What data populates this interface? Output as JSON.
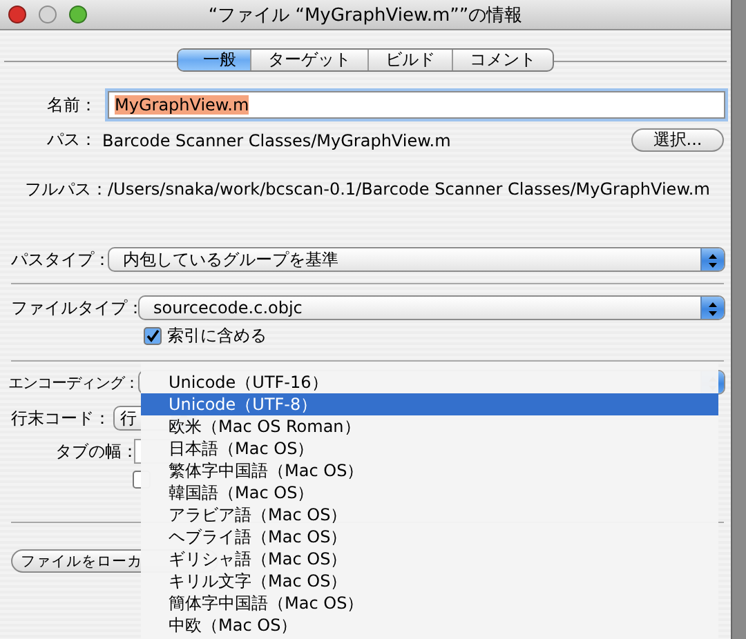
{
  "window": {
    "title": "“ファイル “MyGraphView.m””の情報"
  },
  "tabs": [
    {
      "label": "一般",
      "selected": true
    },
    {
      "label": "ターゲット",
      "selected": false
    },
    {
      "label": "ビルド",
      "selected": false
    },
    {
      "label": "コメント",
      "selected": false
    }
  ],
  "name": {
    "label": "名前：",
    "value": "MyGraphView.m",
    "text_selected": true
  },
  "path": {
    "label": "パス：",
    "value": "Barcode Scanner Classes/MyGraphView.m",
    "button": "選択..."
  },
  "full_path": {
    "label": "フルパス：",
    "value": "/Users/snaka/work/bcscan-0.1/Barcode Scanner Classes/MyGraphView.m"
  },
  "path_type": {
    "label": "パスタイプ：",
    "value": "内包しているグループを基準"
  },
  "file_type": {
    "label": "ファイルタイプ：",
    "value": "sourcecode.c.objc"
  },
  "index_checkbox": {
    "label": "索引に含める",
    "checked": true
  },
  "encoding": {
    "label": "エンコーディング："
  },
  "line_ending": {
    "label": "行末コード：",
    "value": "行"
  },
  "tab_width": {
    "label": "タブの幅："
  },
  "option_checkbox": {
    "checked": false
  },
  "localize_button": {
    "label": "ファイルをローカ"
  },
  "encoding_menu": {
    "items": [
      {
        "label": "Unicode（UTF-16）",
        "selected": false
      },
      {
        "label": "Unicode（UTF-8）",
        "selected": true
      },
      {
        "label": "欧米（Mac OS Roman）",
        "selected": false
      },
      {
        "label": "日本語（Mac OS）",
        "selected": false
      },
      {
        "label": "繁体字中国語（Mac OS）",
        "selected": false
      },
      {
        "label": "韓国語（Mac OS）",
        "selected": false
      },
      {
        "label": "アラビア語（Mac OS）",
        "selected": false
      },
      {
        "label": "ヘブライ語（Mac OS）",
        "selected": false
      },
      {
        "label": "ギリシャ語（Mac OS）",
        "selected": false
      },
      {
        "label": "キリル文字（Mac OS）",
        "selected": false
      },
      {
        "label": "簡体字中国語（Mac OS）",
        "selected": false
      },
      {
        "label": "中欧（Mac OS）",
        "selected": false
      }
    ]
  }
}
